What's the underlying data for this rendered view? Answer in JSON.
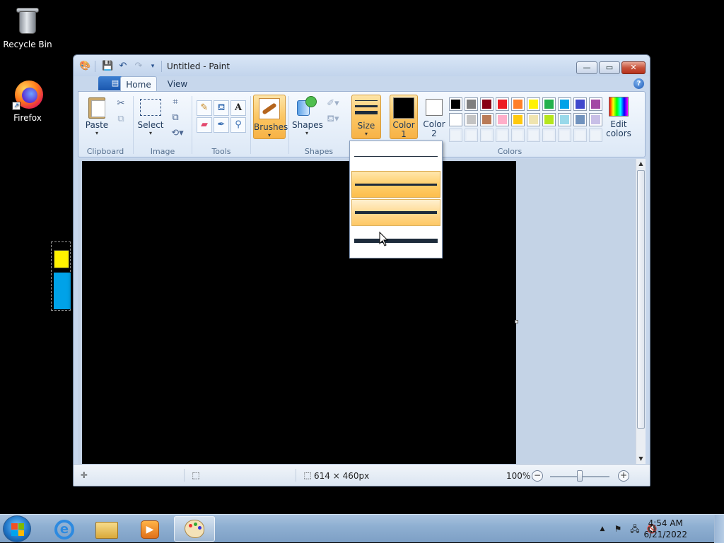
{
  "desktop": {
    "icons": [
      {
        "label": "Recycle Bin",
        "icon": "recycle-bin-icon"
      },
      {
        "label": "Firefox",
        "icon": "firefox-icon"
      }
    ]
  },
  "window": {
    "title": "Untitled - Paint",
    "controls": {
      "minimize": "—",
      "maximize": "▭",
      "close": "✕"
    }
  },
  "ribbon": {
    "file_tab": "▤ ▾",
    "tabs": [
      {
        "label": "Home",
        "active": true
      },
      {
        "label": "View",
        "active": false
      }
    ],
    "help": "?",
    "groups": {
      "clipboard": {
        "label": "Clipboard",
        "paste": "Paste"
      },
      "image": {
        "label": "Image",
        "select": "Select"
      },
      "tools": {
        "label": "Tools"
      },
      "brushes": {
        "label": "Brushes"
      },
      "shapes": {
        "label": "Shapes",
        "button": "Shapes"
      },
      "size": {
        "label": "Size"
      },
      "colors": {
        "label": "Colors",
        "color1": "Color\n1",
        "color2": "Color\n2",
        "color1_value": "#000000",
        "color2_value": "#ffffff",
        "edit": "Edit\ncolors",
        "palette_row1": [
          "#000000",
          "#7f7f7f",
          "#880015",
          "#ed1c24",
          "#ff7f27",
          "#fff200",
          "#22b14c",
          "#00a2e8",
          "#3f48cc",
          "#a349a4"
        ],
        "palette_row2": [
          "#ffffff",
          "#c3c3c3",
          "#b97a57",
          "#ffaec9",
          "#ffc90e",
          "#efe4b0",
          "#b5e61d",
          "#99d9ea",
          "#7092be",
          "#c8bfe7"
        ]
      }
    }
  },
  "size_dropdown": {
    "options": [
      "1px",
      "3px",
      "5px",
      "8px"
    ],
    "selected_index": 1,
    "hover_index": 2
  },
  "canvas": {
    "background": "#000000"
  },
  "statusbar": {
    "dimensions": "614 × 460px",
    "zoom": "100%",
    "zoom_level": 1.0
  },
  "taskbar": {
    "items": [
      "internet-explorer-icon",
      "windows-explorer-icon",
      "media-player-icon",
      "paint-icon"
    ],
    "active_item": "paint-icon",
    "time": "4:54 AM",
    "date": "6/21/2022"
  }
}
